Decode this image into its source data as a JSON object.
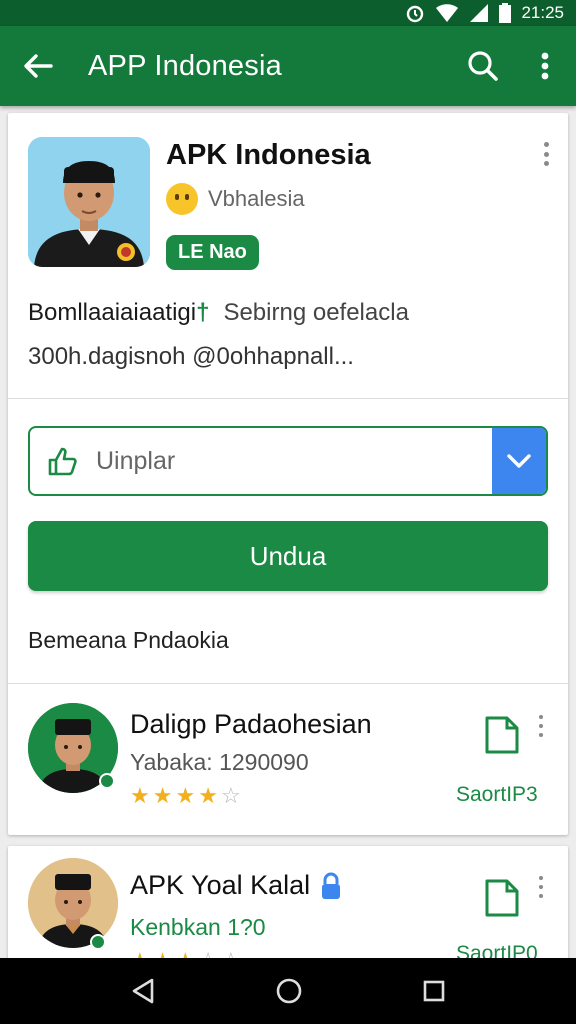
{
  "status_bar": {
    "time": "21:25"
  },
  "app_bar": {
    "title": "APP Indonesia"
  },
  "app_card": {
    "name": "APK Indonesia",
    "subtitle": "Vbhalesia",
    "badge": "LE Nao",
    "description_line1": "Bomllaaiaiaatigi",
    "description_line1_extra": "Sebirng oefelacla",
    "description_line2": "300h.dagisnoh @0ohhapnall...",
    "select": {
      "value": "Uinplar"
    },
    "download_label": "Undua",
    "section_label": "Bemeana Pndaokia"
  },
  "list": [
    {
      "title": "Daligp Padaohesian",
      "subtitle": "Yabaka: 1290090",
      "rating": 3.5,
      "action_label": "SaortIP3"
    },
    {
      "title": "APK Yoal Kalal",
      "subtitle": "Kenbkan 1?0",
      "rating": 3,
      "action_label": "SaortIP0"
    }
  ],
  "colors": {
    "primary": "#137a3c",
    "accent": "#1a8a44",
    "select_chevron": "#3d86f0",
    "star": "#f2b01e"
  }
}
